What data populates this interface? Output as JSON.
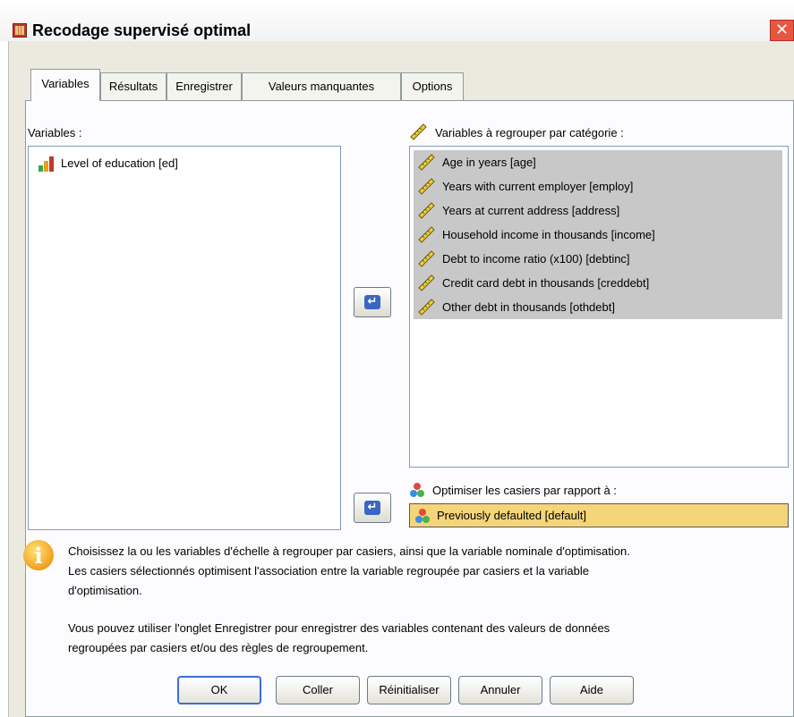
{
  "window": {
    "title": "Recodage supervisé optimal",
    "close_glyph": "✕"
  },
  "tabs": [
    {
      "label": "Variables",
      "active": true
    },
    {
      "label": "Résultats"
    },
    {
      "label": "Enregistrer"
    },
    {
      "label": "Valeurs manquantes"
    },
    {
      "label": "Options"
    }
  ],
  "left_list": {
    "label": "Variables :",
    "items": [
      {
        "text": "Level of education [ed]",
        "icon": "ordinal-bar-icon"
      }
    ]
  },
  "bin_list": {
    "label": "Variables à regrouper par catégorie :",
    "items": [
      {
        "text": "Age in years [age]",
        "icon": "scale-ruler-icon"
      },
      {
        "text": "Years with current employer [employ]",
        "icon": "scale-ruler-icon"
      },
      {
        "text": "Years at current address [address]",
        "icon": "scale-ruler-icon"
      },
      {
        "text": "Household income in thousands [income]",
        "icon": "scale-ruler-icon"
      },
      {
        "text": "Debt to income ratio (x100) [debtinc]",
        "icon": "scale-ruler-icon"
      },
      {
        "text": "Credit card debt in thousands [creddebt]",
        "icon": "scale-ruler-icon"
      },
      {
        "text": "Other debt in thousands [othdebt]",
        "icon": "scale-ruler-icon"
      }
    ]
  },
  "optimize": {
    "label": "Optimiser les casiers par rapport à :",
    "value": "Previously defaulted [default]",
    "icon": "nominal-icon"
  },
  "help": {
    "line1": "Choisissez la ou les variables d'échelle à regrouper par casiers, ainsi que la variable nominale d'optimisation.",
    "line2": "Les casiers sélectionnés optimisent l'association entre la variable regroupée par casiers et la variable",
    "line3": "d'optimisation.",
    "line4": "Vous pouvez utiliser l'onglet Enregistrer pour enregistrer des variables contenant des valeurs de données",
    "line5": "regroupées par casiers et/ou des règles de regroupement."
  },
  "buttons": {
    "ok": "OK",
    "paste": "Coller",
    "reset": "Réinitialiser",
    "cancel": "Annuler",
    "help": "Aide"
  },
  "colors": {
    "dialog_bg": "#eceade",
    "selection": "#c8c8c8",
    "target_highlight": "#f5d57a",
    "arrow_blue": "#3c66c4"
  }
}
